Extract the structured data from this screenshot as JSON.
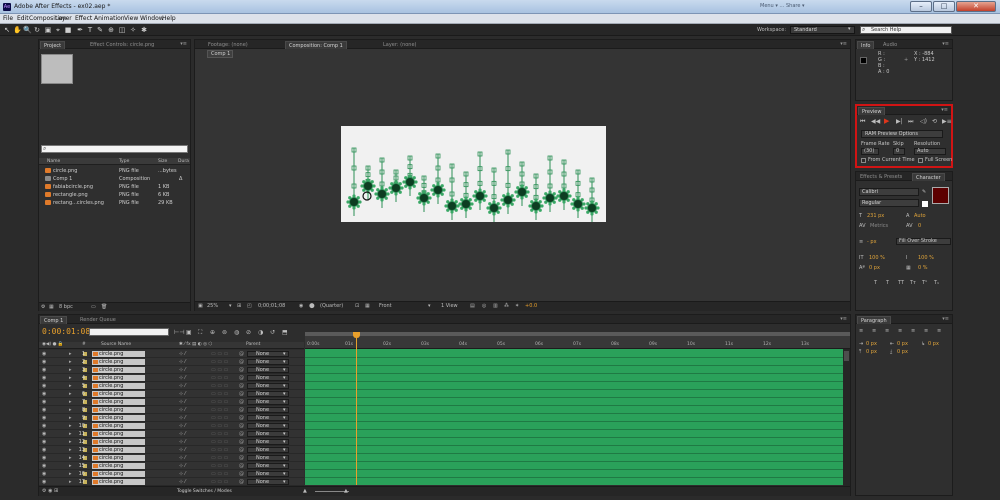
{
  "window": {
    "title": "Adobe After Effects - ex02.aep *",
    "right_caption": "Menu ▾ … Share ▾",
    "min_glyph": "–",
    "max_glyph": "□",
    "close_glyph": "✕"
  },
  "menu": [
    "File",
    "Edit",
    "Composition",
    "Layer",
    "Effect",
    "Animation",
    "View",
    "Window",
    "Help"
  ],
  "toolbar": {
    "tools": [
      "selection-tool-icon",
      "hand-tool-icon",
      "zoom-tool-icon",
      "rotate-tool-icon",
      "camera-tool-icon",
      "pan-behind-tool-icon",
      "rectangle-tool-icon",
      "pen-tool-icon",
      "type-tool-icon",
      "brush-tool-icon",
      "clone-stamp-tool-icon",
      "eraser-tool-icon",
      "roto-brush-tool-icon",
      "puppet-pin-tool-icon"
    ],
    "tool_glyphs": [
      "↖",
      "✋",
      "🔍",
      "↻",
      "▣",
      "⌖",
      "■",
      "✒",
      "T",
      "✎",
      "⊕",
      "◫",
      "✧",
      "✱"
    ],
    "workspace_label": "Workspace:",
    "workspace_value": "Standard",
    "search_placeholder": "Search Help",
    "search_glyph": "⌕"
  },
  "project_panel": {
    "tabs": [
      "Project",
      "Effect Controls: circle.png"
    ],
    "menu_glyph": "▾≡",
    "search_glyph": "⌕",
    "columns": {
      "name": "Name",
      "type": "Type",
      "size": "Size",
      "duration": "Dura"
    },
    "items": [
      {
        "name": "circle.png",
        "type": "PNG file",
        "size": "...bytes",
        "duration": "",
        "color": "#e07a2a"
      },
      {
        "name": "Comp 1",
        "type": "Composition",
        "size": "",
        "duration": "Δ",
        "color": "#8a8a8a"
      },
      {
        "name": "fabiabcircle.png",
        "type": "PNG file",
        "size": "1 KB",
        "duration": "",
        "color": "#e07a2a"
      },
      {
        "name": "rectangle.png",
        "type": "PNG file",
        "size": "6 KB",
        "duration": "",
        "color": "#e07a2a"
      },
      {
        "name": "rectang...circles.png",
        "type": "PNG file",
        "size": "29 KB",
        "duration": "",
        "color": "#e07a2a"
      }
    ],
    "footer": {
      "bpc": "8 bpc",
      "glyphs": [
        "⚙",
        "▦",
        "▭",
        "🗑"
      ]
    }
  },
  "comp_panel": {
    "tabs": [
      "Footage: (none)",
      "Composition: Comp 1",
      "Layer: (none)"
    ],
    "breadcrumb": "Comp 1",
    "footer": {
      "zoom": "25%",
      "timecode": "0;00;01;08",
      "resolution": "(Quarter)",
      "view": "Front",
      "views": "1 View",
      "exposure": "+0.0"
    }
  },
  "info_panel": {
    "tabs": [
      "Info",
      "Audio"
    ],
    "rgba": [
      "R :",
      "G :",
      "B :",
      "A : 0"
    ],
    "coords": [
      "X : -884",
      "Y : 1412"
    ]
  },
  "preview_panel": {
    "tab": "Preview",
    "controls": [
      "⏮",
      "◀◀",
      "▶",
      "▶|",
      "⏭",
      "◁)",
      "⟲",
      "▶≡"
    ],
    "ram_options": "RAM Preview Options",
    "frame_rate_label": "Frame Rate",
    "skip_label": "Skip",
    "resolution_label": "Resolution",
    "frame_rate_value": "(30)",
    "skip_value": "0",
    "resolution_value": "Auto",
    "from_current_time": "From Current Time",
    "full_screen": "Full Screen"
  },
  "character_panel": {
    "tabs": [
      "Effects & Presets",
      "Character"
    ],
    "font": "Calibri",
    "style": "Regular",
    "size": "231 px",
    "leading": "Auto",
    "kerning": "Metrics",
    "tracking": "0",
    "stroke_width": "- px",
    "stroke_mode": "Fill Over Stroke",
    "vert_scale": "100 %",
    "horiz_scale": "100 %",
    "baseline": "0 px",
    "tsume": "0 %",
    "styles": [
      "T",
      "T",
      "TT",
      "Tт",
      "T¹",
      "T₁"
    ]
  },
  "paragraph_panel": {
    "tab": "Paragraph",
    "indents": [
      "0 px",
      "0 px",
      "0 px",
      "0 px",
      "0 px"
    ]
  },
  "timeline": {
    "tabs": [
      "Comp 1",
      "Render Queue"
    ],
    "current_time": "0:00:01:08",
    "col_source_name": "Source Name",
    "col_parent": "Parent",
    "col_num": "#",
    "ruler_ticks": [
      "0:00s",
      "01s",
      "02s",
      "03s",
      "04s",
      "05s",
      "06s",
      "07s",
      "08s",
      "09s",
      "10s",
      "11s",
      "12s",
      "13s"
    ],
    "layers": [
      {
        "num": "1",
        "name": "circle.png",
        "parent": "None"
      },
      {
        "num": "2",
        "name": "circle.png",
        "parent": "None"
      },
      {
        "num": "3",
        "name": "circle.png",
        "parent": "None"
      },
      {
        "num": "4",
        "name": "circle.png",
        "parent": "None"
      },
      {
        "num": "5",
        "name": "circle.png",
        "parent": "None"
      },
      {
        "num": "6",
        "name": "circle.png",
        "parent": "None"
      },
      {
        "num": "7",
        "name": "circle.png",
        "parent": "None"
      },
      {
        "num": "8",
        "name": "circle.png",
        "parent": "None"
      },
      {
        "num": "9",
        "name": "circle.png",
        "parent": "None"
      },
      {
        "num": "10",
        "name": "circle.png",
        "parent": "None"
      },
      {
        "num": "11",
        "name": "circle.png",
        "parent": "None"
      },
      {
        "num": "12",
        "name": "circle.png",
        "parent": "None"
      },
      {
        "num": "13",
        "name": "circle.png",
        "parent": "None"
      },
      {
        "num": "14",
        "name": "circle.png",
        "parent": "None"
      },
      {
        "num": "15",
        "name": "circle.png",
        "parent": "None"
      },
      {
        "num": "16",
        "name": "circle.png",
        "parent": "None"
      },
      {
        "num": "17",
        "name": "circle.png",
        "parent": "None"
      }
    ],
    "toggle_label": "Toggle Switches / Modes"
  },
  "colors": {
    "accent_orange": "#e8a02c",
    "track_green": "#2aa15a",
    "highlight_red": "#d11414"
  }
}
